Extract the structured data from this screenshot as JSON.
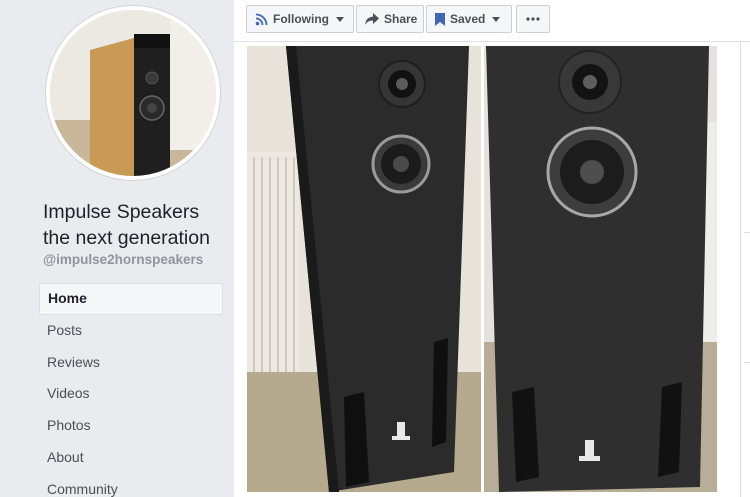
{
  "page": {
    "name_line1": "Impulse Speakers",
    "name_line2": "the next generation",
    "handle": "@impulse2hornspeakers"
  },
  "nav": {
    "items": [
      {
        "label": "Home",
        "active": true
      },
      {
        "label": "Posts"
      },
      {
        "label": "Reviews"
      },
      {
        "label": "Videos"
      },
      {
        "label": "Photos"
      },
      {
        "label": "About"
      },
      {
        "label": "Community"
      }
    ]
  },
  "actions": {
    "following": "Following",
    "share": "Share",
    "saved": "Saved"
  },
  "icons": {
    "following": "rss-icon",
    "share": "share-arrow-icon",
    "saved": "bookmark-icon",
    "more": "more-dots-icon"
  },
  "colors": {
    "background": "#e9ebee",
    "accent": "#4267b2",
    "speaker_cabinet": "#2b2b2b",
    "logo_mark": "#e8e8e8"
  }
}
